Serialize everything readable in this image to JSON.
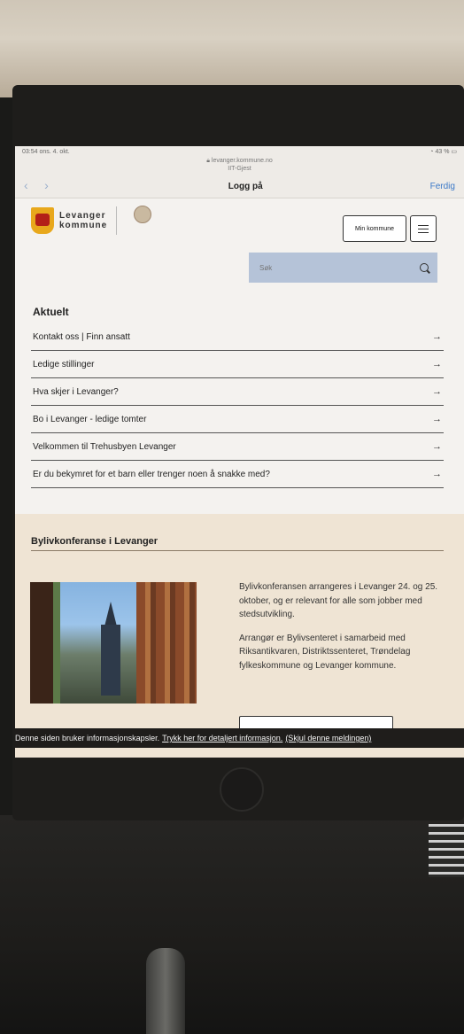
{
  "status_bar": {
    "time_date": "03:54  ons. 4. okt.",
    "battery": "43 %"
  },
  "browser": {
    "url": "levanger.kommune.no",
    "network": "IIT-Gjest",
    "title": "Logg på",
    "done_label": "Ferdig"
  },
  "site": {
    "logo_line1": "Levanger",
    "logo_line2": "kommune",
    "min_kommune_label": "Min kommune",
    "search_placeholder": "Søk"
  },
  "aktuelt": {
    "title": "Aktuelt",
    "items": [
      "Kontakt oss | Finn ansatt",
      "Ledige stillinger",
      "Hva skjer i Levanger?",
      "Bo i Levanger - ledige tomter",
      "Velkommen til Trehusbyen Levanger",
      "Er du bekymret for et barn eller trenger noen å snakke med?"
    ]
  },
  "feature": {
    "title": "Bylivkonferanse i Levanger",
    "paragraph1": "Bylivkonferansen arrangeres i Levanger 24. og 25. oktober, og er relevant for alle som jobber med stedsutvikling.",
    "paragraph2": "Arrangør er Bylivsenteret i samarbeid med Riksantikvaren, Distriktssenteret, Trøndelag fylkeskommune og Levanger kommune."
  },
  "cookie": {
    "text": "Denne siden bruker informasjonskapsler.",
    "details_link": "Trykk her for detaljert informasjon.",
    "hide_link": "(Skjul denne meldingen)"
  }
}
